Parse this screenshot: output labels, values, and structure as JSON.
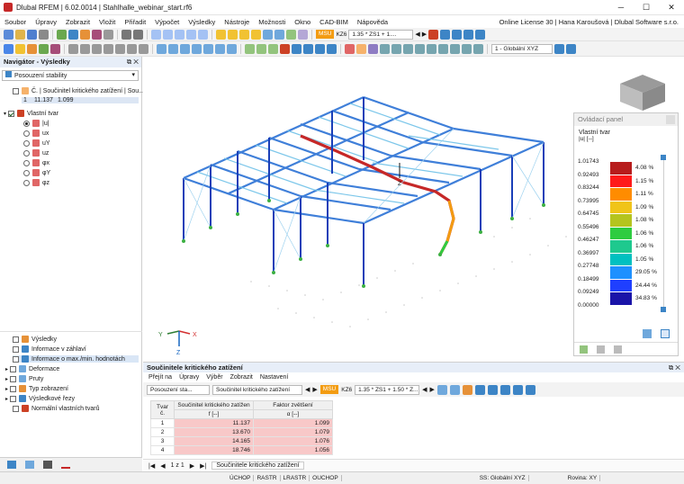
{
  "window": {
    "title": "Dlubal RFEM | 6.02.0014 | Stahlhalle_webinar_start.rf6",
    "license": "Online License 30 | Hana Karoušová | Dlubal Software s.r.o."
  },
  "menu": [
    "Soubor",
    "Úpravy",
    "Zobrazit",
    "Vložit",
    "Přiřadit",
    "Výpočet",
    "Výsledky",
    "Nástroje",
    "Možnosti",
    "Okno",
    "CAD-BIM",
    "Nápověda"
  ],
  "toolbar1": {
    "msu_tag": "MSU",
    "kz_tag": "KZ6",
    "combo": "1.35 * ZS1 + 1...."
  },
  "toolbar2": {
    "coord_combo": "1 - Globální XYZ"
  },
  "navigator": {
    "title": "Navigátor - Výsledky",
    "dropdown": "Posouzení stability",
    "results_header": "Č. | Součinitel kritického zatížení | Sou...",
    "first_row": {
      "num": "1",
      "f": "11.137",
      "alpha": "1.099"
    },
    "mode_shape": "Vlastní tvar",
    "options": [
      "|u|",
      "ux",
      "uY",
      "uz",
      "φx",
      "φY",
      "φz"
    ],
    "lower_items": [
      "Výsledky",
      "Informace v záhlaví",
      "Informace o max./min. hodnotách",
      "Deformace",
      "Pruty",
      "Typ zobrazení",
      "Výsledkové řezy",
      "Normální vlastních tvarů"
    ]
  },
  "axes": {
    "x": "X",
    "y": "Y",
    "z": "Z",
    "vz": "Z"
  },
  "control_panel": {
    "title": "Ovládací panel",
    "subtitle": "Vlastní tvar",
    "unit": "|u| [--]",
    "values": [
      "1.01743",
      "0.92493",
      "0.83244",
      "0.73995",
      "0.64745",
      "0.55496",
      "0.46247",
      "0.36997",
      "0.27748",
      "0.18499",
      "0.09249",
      "0.00000"
    ],
    "colors": [
      "#b71c1c",
      "#ff1a1a",
      "#ff8c00",
      "#f0c419",
      "#b5c41e",
      "#2ecc40",
      "#1ec98e",
      "#00c0c0",
      "#1e90ff",
      "#1f3fff",
      "#1a14a8"
    ],
    "percents": [
      "4.08 %",
      "1.15 %",
      "1.11 %",
      "1.09 %",
      "1.08 %",
      "1.06 %",
      "1.06 %",
      "1.05 %",
      "29.05 %",
      "24.44 %",
      "34.83 %"
    ]
  },
  "bottom": {
    "title": "Součinitele kritického zatížení",
    "menu": [
      "Přejít na",
      "Úpravy",
      "Výběr",
      "Zobrazit",
      "Nastavení"
    ],
    "dd1": "Posouzení sta...",
    "dd2": "Součinitel kritického zatížení",
    "msu": "MSU",
    "kz": "KZ6",
    "combo": "1.35 * ZS1 + 1.50 * Z...",
    "columns": {
      "mode": "Tvar č.",
      "f_top": "Součinitel kritického zatížen",
      "f_unit": "f [--]",
      "a_top": "Faktor zvětšení",
      "a_unit": "α [--]"
    },
    "rows": [
      {
        "n": "1",
        "f": "11.137",
        "a": "1.099"
      },
      {
        "n": "2",
        "f": "13.670",
        "a": "1.079"
      },
      {
        "n": "3",
        "f": "14.165",
        "a": "1.076"
      },
      {
        "n": "4",
        "f": "18.746",
        "a": "1.056"
      }
    ],
    "pager": "1 z 1",
    "tab": "Součinitele kritického zatížení"
  },
  "status": [
    "ÚCHOP",
    "RASTR",
    "LRASTR",
    "OUCHOP",
    "SS: Globální XYZ",
    "Rovina: XY"
  ]
}
